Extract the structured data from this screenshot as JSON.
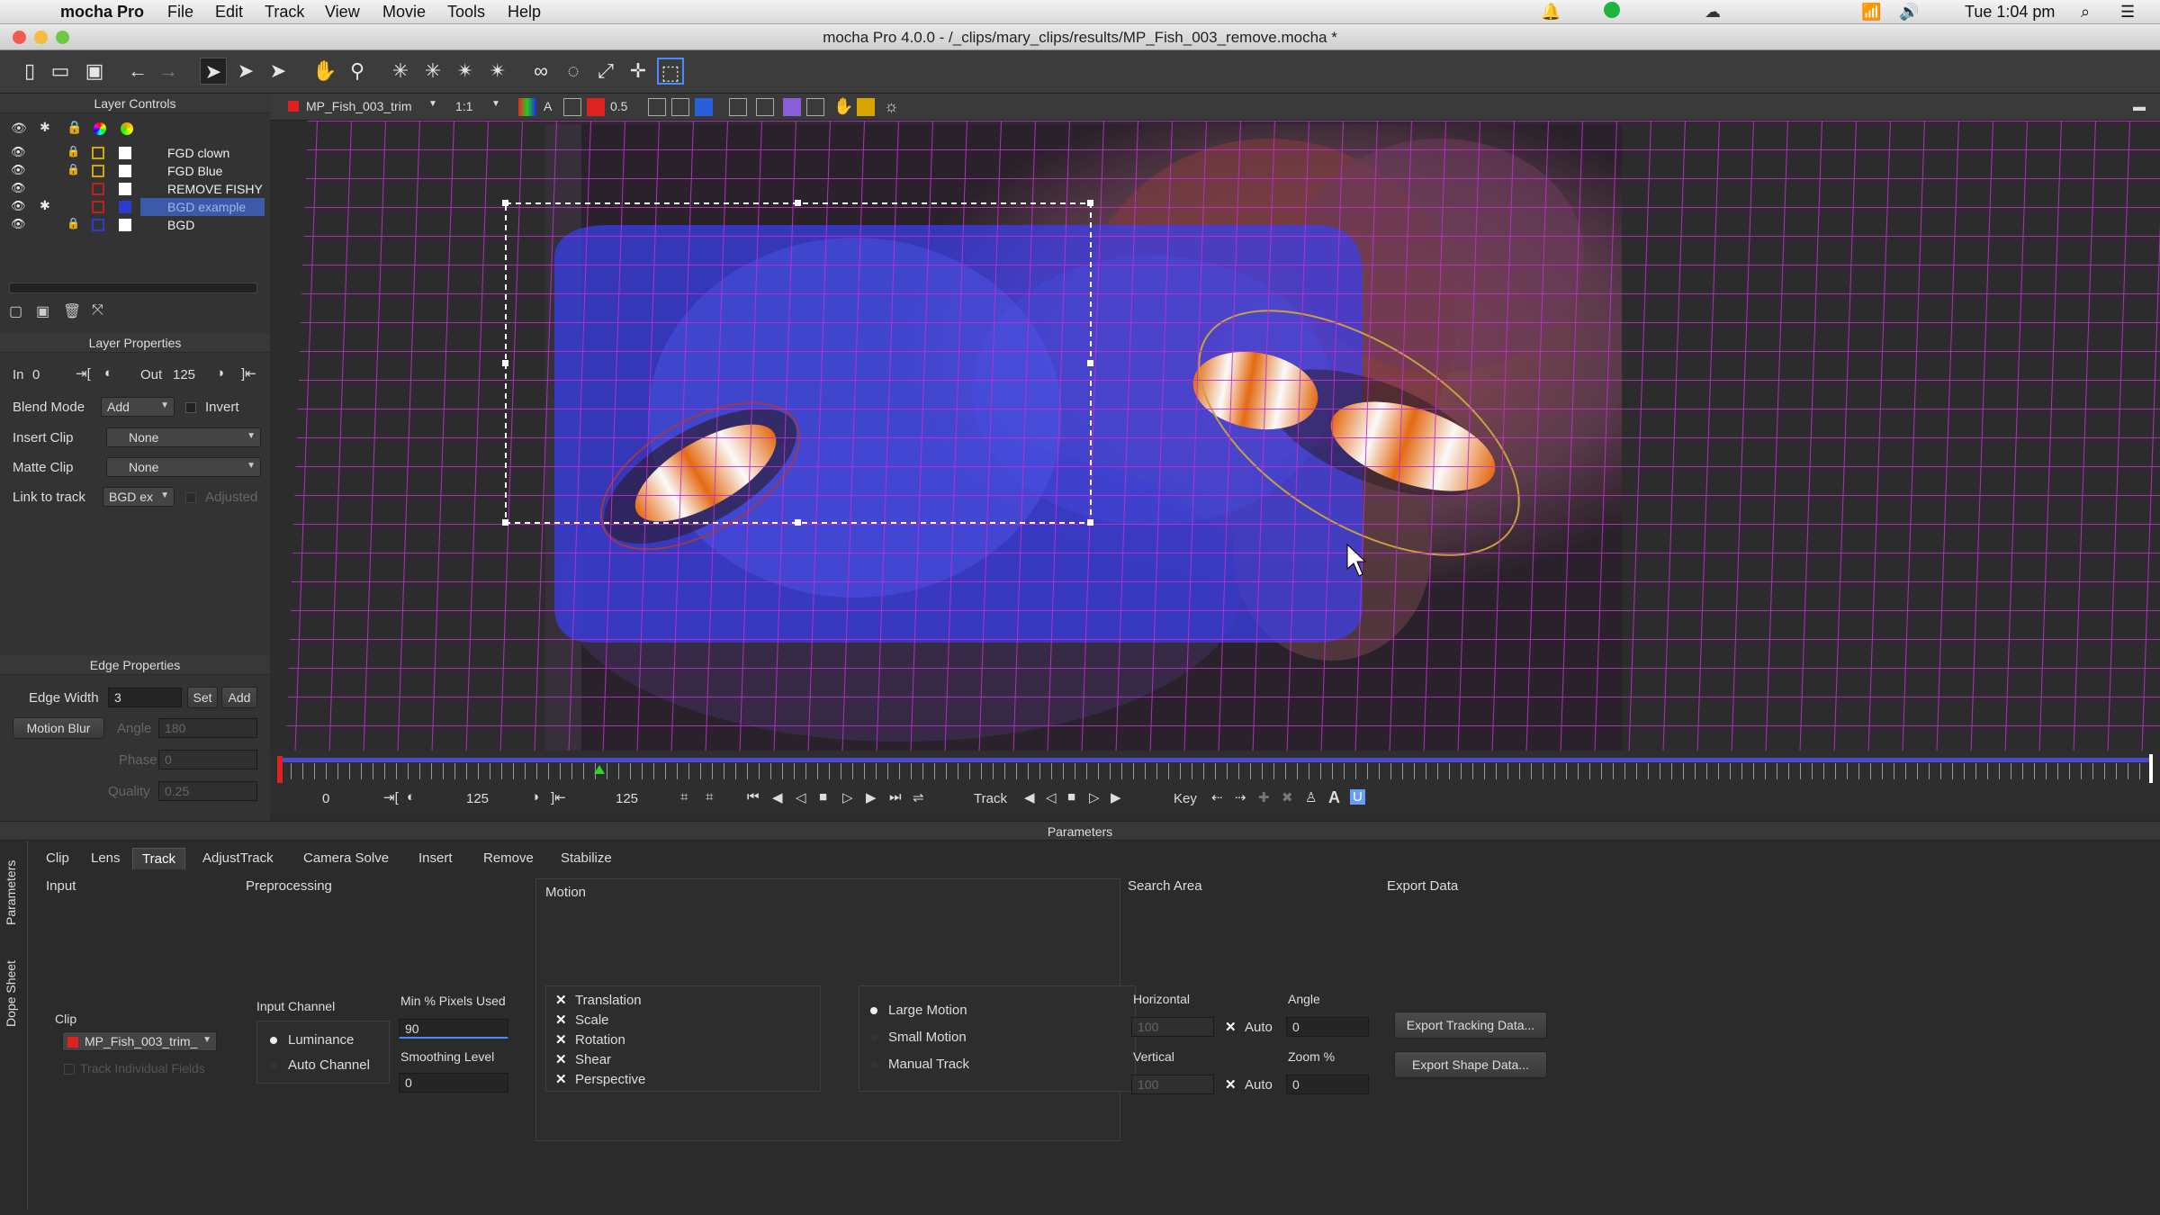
{
  "menubar": {
    "app_name": "mocha Pro",
    "items": [
      "File",
      "Edit",
      "Track",
      "View",
      "Movie",
      "Tools",
      "Help"
    ],
    "clock": "Tue 1:04 pm"
  },
  "window": {
    "title": "mocha Pro 4.0.0 - /_clips/mary_clips/results/MP_Fish_003_remove.mocha *"
  },
  "layer_controls": {
    "title": "Layer Controls",
    "layers": [
      {
        "name": "FGD clown",
        "color": "#d8a400",
        "selected": false
      },
      {
        "name": "FGD Blue",
        "color": "#d8a400",
        "selected": false
      },
      {
        "name": "REMOVE FISHY",
        "color": "#c0201c",
        "selected": false
      },
      {
        "name": "BGD example",
        "color": "#c0201c",
        "selected": true
      },
      {
        "name": "BGD",
        "color": "#2a3bd0",
        "selected": false
      }
    ]
  },
  "layer_properties": {
    "title": "Layer Properties",
    "in_label": "In",
    "in_value": "0",
    "out_label": "Out",
    "out_value": "125",
    "blend_mode_label": "Blend Mode",
    "blend_mode_value": "Add",
    "invert_label": "Invert",
    "insert_clip_label": "Insert Clip",
    "insert_clip_value": "None",
    "matte_clip_label": "Matte Clip",
    "matte_clip_value": "None",
    "link_to_track_label": "Link to track",
    "link_to_track_value": "BGD ex",
    "adjusted_label": "Adjusted"
  },
  "edge_properties": {
    "title": "Edge Properties",
    "edge_width_label": "Edge Width",
    "edge_width_value": "3",
    "set_label": "Set",
    "add_label": "Add",
    "motion_blur_label": "Motion Blur",
    "angle_label": "Angle",
    "angle_value": "180",
    "phase_label": "Phase",
    "phase_value": "0",
    "quality_label": "Quality",
    "quality_value": "0.25"
  },
  "viewer": {
    "clip_name": "MP_Fish_003_trim",
    "zoom": "1:1",
    "opacity": "0.5"
  },
  "timeline": {
    "start": "0",
    "in_value": "125",
    "out_value": "125",
    "track_label": "Track",
    "key_label": "Key"
  },
  "parameters": {
    "title": "Parameters",
    "tabs": [
      "Clip",
      "Lens",
      "Track",
      "AdjustTrack",
      "Camera Solve",
      "Insert",
      "Remove",
      "Stabilize"
    ],
    "active_tab": "Track",
    "side_tabs": [
      "Parameters",
      "Dope Sheet"
    ],
    "input": {
      "title": "Input",
      "clip_label": "Clip",
      "clip_value": "MP_Fish_003_trim_",
      "track_fields_label": "Track Individual Fields"
    },
    "preprocessing": {
      "title": "Preprocessing",
      "input_channel_label": "Input Channel",
      "luminance_label": "Luminance",
      "auto_channel_label": "Auto Channel",
      "min_pixels_label": "Min % Pixels Used",
      "min_pixels_value": "90",
      "smoothing_label": "Smoothing Level",
      "smoothing_value": "0"
    },
    "motion": {
      "title": "Motion",
      "checks": [
        "Translation",
        "Scale",
        "Rotation",
        "Shear",
        "Perspective"
      ],
      "modes": [
        "Large Motion",
        "Small Motion",
        "Manual Track"
      ],
      "selected_mode": "Large Motion"
    },
    "search_area": {
      "title": "Search Area",
      "horizontal_label": "Horizontal",
      "horizontal_value": "100",
      "vertical_label": "Vertical",
      "vertical_value": "100",
      "auto_label": "Auto",
      "angle_label": "Angle",
      "angle_value": "0",
      "zoom_label": "Zoom %",
      "zoom_value": "0"
    },
    "export_data": {
      "title": "Export Data",
      "export_tracking_label": "Export Tracking Data...",
      "export_shape_label": "Export Shape Data..."
    }
  }
}
